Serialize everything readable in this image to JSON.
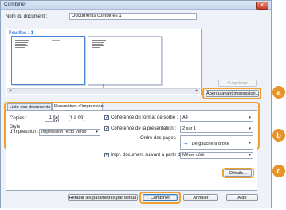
{
  "window": {
    "title": "Combiner",
    "close_glyph": "✕"
  },
  "doc_name": {
    "label": "Nom du document :",
    "value": "Documents combinés 1"
  },
  "preview": {
    "sheets_label": "Feuilles : 1",
    "page_number": "1",
    "scroll_left": "◂",
    "scroll_right": "▸"
  },
  "buttons": {
    "delete": "Supprimer",
    "print_preview": "Aperçu avant impression...",
    "details": "Détails...",
    "reset": "Rétablir les paramètres par défaut",
    "combine": "Combiner",
    "cancel": "Annuler",
    "help": "Aide"
  },
  "tabs": [
    "Liste des documents",
    "Paramètres d'impression"
  ],
  "settings": {
    "copies_label": "Copies :",
    "copies_value": "1",
    "copies_range": "[1 à 99]",
    "style_label": "Style d'impression :",
    "style_value": "Impression recto verso",
    "output_format_label": "Cohérence du format de sortie :",
    "output_format_value": "A4",
    "layout_label": "Cohérence de la présentation :",
    "layout_value": "2 sur 1",
    "page_order_label": "Ordre des pages :",
    "page_order_value": "De gauche à droite",
    "print_after_label": "Impr. document suivant à partir de :",
    "print_after_value": "Même côté",
    "checkmark": "✓",
    "dropdown_arrow": "▾",
    "spin_up": "▲",
    "spin_down": "▼",
    "order_arrow": "→"
  },
  "callouts": [
    "a",
    "b",
    "c"
  ],
  "colors": {
    "accent": "#e8922a",
    "link_blue": "#2a6fd6"
  }
}
